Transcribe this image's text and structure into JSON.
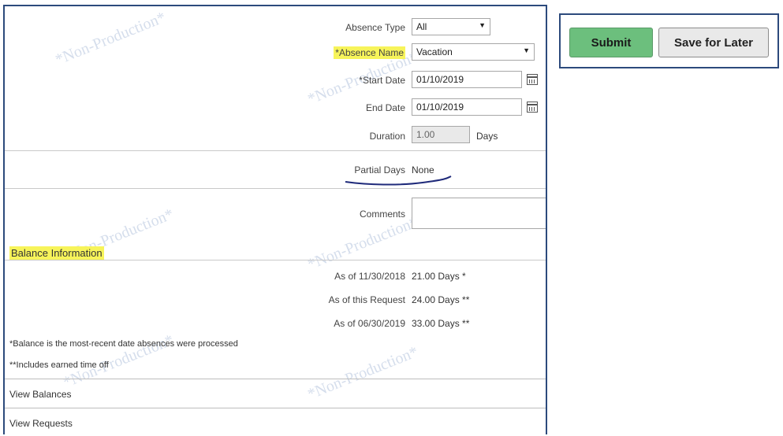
{
  "watermark": "*Non-Production*",
  "form": {
    "absence_type": {
      "label": "Absence Type",
      "value": "All"
    },
    "absence_name": {
      "label": "*Absence Name",
      "value": "Vacation"
    },
    "start_date": {
      "label": "*Start Date",
      "value": "01/10/2019"
    },
    "end_date": {
      "label": "End Date",
      "value": "01/10/2019"
    },
    "duration": {
      "label": "Duration",
      "value": "1.00",
      "unit": "Days"
    },
    "partial_days": {
      "label": "Partial Days",
      "value": "None"
    },
    "comments": {
      "label": "Comments",
      "value": ""
    }
  },
  "balance": {
    "title": "Balance Information",
    "rows": [
      {
        "label": "As of 11/30/2018",
        "value": "21.00 Days *"
      },
      {
        "label": "As of this Request",
        "value": "24.00 Days **"
      },
      {
        "label": "As of 06/30/2019",
        "value": "33.00 Days **"
      }
    ],
    "note1": "*Balance is the most-recent date absences were processed",
    "note2": "**Includes earned time off"
  },
  "links": {
    "view_balances": "View Balances",
    "view_requests": "View Requests"
  },
  "buttons": {
    "submit": "Submit",
    "save_later": "Save for Later"
  },
  "colors": {
    "border": "#2c4a7c",
    "submit_bg": "#6cbf7d",
    "highlight": "#f7f45a"
  }
}
